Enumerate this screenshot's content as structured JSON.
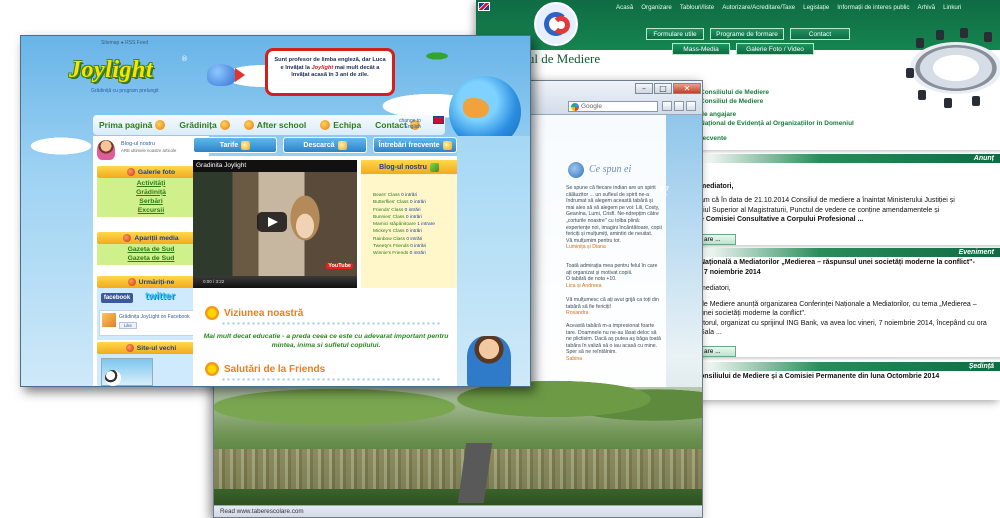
{
  "w3": {
    "nav": [
      "Acasă",
      "Organizare",
      "Tablouri/liste",
      "Autorizare/Acreditare/Taxe",
      "Legislație",
      "Informații de interes public",
      "Arhivă",
      "Linkuri"
    ],
    "brand": "siliul de Mediere",
    "buttons": [
      "Formulare utile",
      "Programe de formare",
      "Contact",
      "Mass-Media",
      "Galerie Foto / Video"
    ],
    "side_links": [
      "Consiliului de Mediere",
      "Consiliul de Mediere",
      "de angajare",
      "Național de Evidență al Organizațiilor în Domeniul",
      "recvente"
    ],
    "bands": [
      "Anunț",
      "Eveniment",
      "Ședință"
    ],
    "para1_title": "mediatori,",
    "para1": [
      "am că în data de 21.10.2014 Consiliul de mediere a înaintat Ministerului Justiției și",
      "iliul Superior al Magistraturii, Punctul de vedere ce conține amendamentele și",
      "e Comisiei Consultative a Corpului Profesional ..."
    ],
    "para2_title": "Națională a Mediatorilor „Medierea – răspunsul unei societăți moderne la conflict\"-",
    "para2_sub": ", 7 noiembrie 2014",
    "para2": [
      "mediatori,",
      "de Mediere anunță organizarea Conferinței Naționale a Mediatorilor, cu tema „Medierea –",
      "unei societăți moderne la conflict\".",
      "iitorul, organizat cu sprijinul ING Bank, va avea loc vineri, 7 noiembrie 2014, începând cu ora",
      "Sala ..."
    ],
    "para3": "onsiliului de Mediere și a Comisiei Permanente din luna Octombrie 2014",
    "more": "are ..."
  },
  "w2": {
    "search_placeholder": "Google",
    "title": "Ce spun ei",
    "testimonials": [
      {
        "text": [
          "Se spune că fiecare indian are un spirit",
          "călăuzitor ... un sufleul de spirit ne-a",
          "îndrumat să alegem această tabără și",
          "mai ales să vă alegem pe voi: Lili, Costy,",
          "Geanina, Lumi, Crisfi. Ne-ndrepțim către",
          "„corturile noastre\" cu tolba plină:",
          "experiențe noi, imagini încântătoare, copii",
          "fericiți și mulțumiți, amintiri de neuitat.",
          "Vă mulțumim pentru tot."
        ],
        "sign": "Luminița și Diana"
      },
      {
        "text": [
          "Toată admirația mea pentru felul în care",
          "ați organizat și motivat copiii.",
          "O tabără de nota +10."
        ],
        "sign": "Lica și Andreea"
      },
      {
        "text": [
          "Vă mulțumesc că ați avut grijă ca toți din",
          "tabără să fie fericiți!"
        ],
        "sign": "Roxandra"
      },
      {
        "text": [
          "Această tabără m-a impresionat foarte",
          "tare. Doamnele nu ne-au lăsat deloc să",
          "ne plictisim. Dacă aș putea aș băga toată",
          "tabăra în valiză să o iau acasă cu mine.",
          "Sper să ne reîntâlnim."
        ],
        "sign": "Sabina"
      }
    ],
    "status": "Read www.taberescolare.com"
  },
  "w1": {
    "topline": "Sitemap  ●  RSS Feed",
    "logo": "Joylight",
    "tagline": "Grădiniță cu program prelungit",
    "bubble": {
      "pre": "Sunt profesor de limba engleză, dar Luca e învățat la",
      "brand": "Joylight",
      "post": "mai mult decât a învățat acasă în 3 ani de zile."
    },
    "nav": [
      "Prima pagină",
      "Grădinița",
      "After school",
      "Echipa",
      "Contact"
    ],
    "lang": [
      "change to",
      "English"
    ],
    "blog_title": "Blog-ul nostru",
    "blog_sub": "ARE ultimele noastre articole",
    "gallery": {
      "title": "Galerie foto",
      "items": [
        "Activități",
        "Grădiniță",
        "Serbări",
        "Excursii"
      ]
    },
    "media": {
      "title": "Apariții media",
      "items": [
        "Gazeta de Sud",
        "Gazeta de Sud"
      ]
    },
    "follow": {
      "title": "Urmăriți-ne",
      "fb": "facebook",
      "tw": "twitter",
      "fb_name": "Grădinița JoyLight",
      "fb_suffix": "on Facebook",
      "like": "Like"
    },
    "old_site": {
      "title": "Site-ul vechi"
    },
    "tabs": [
      "Tarife",
      "Descarcă",
      "Întrebări frecvente"
    ],
    "video_title": "Gradinita Joylight",
    "video_time": "0:00 / 3:22",
    "yt": "YouTube",
    "blog_box": {
      "title": "Blog-ul nostru",
      "items": [
        {
          "name": "Bears' Class",
          "n": "0 intrări"
        },
        {
          "name": "Butterflies' Class",
          "n": "0 intrări"
        },
        {
          "name": "Friends' Class",
          "n": "0 intrări"
        },
        {
          "name": "Bunnies' Class",
          "n": "0 intrări"
        },
        {
          "name": "Mamici stǎpânitoare",
          "n": "1 intrare"
        },
        {
          "name": "Mickey's Class",
          "n": "0 intrări"
        },
        {
          "name": "Rainbow Class",
          "n": "0 intrări"
        },
        {
          "name": "Tweety's Friends",
          "n": "0 intrări"
        },
        {
          "name": "Winnie's Friends",
          "n": "0 intrări"
        }
      ]
    },
    "vision_title": "Viziunea noastră",
    "mission": "Mai mult decat educatie - a preda ceea ce este cu adevarat important pentru mintea, inima si sufletul copilului.",
    "greetings_title": "Salutări de la Friends"
  }
}
